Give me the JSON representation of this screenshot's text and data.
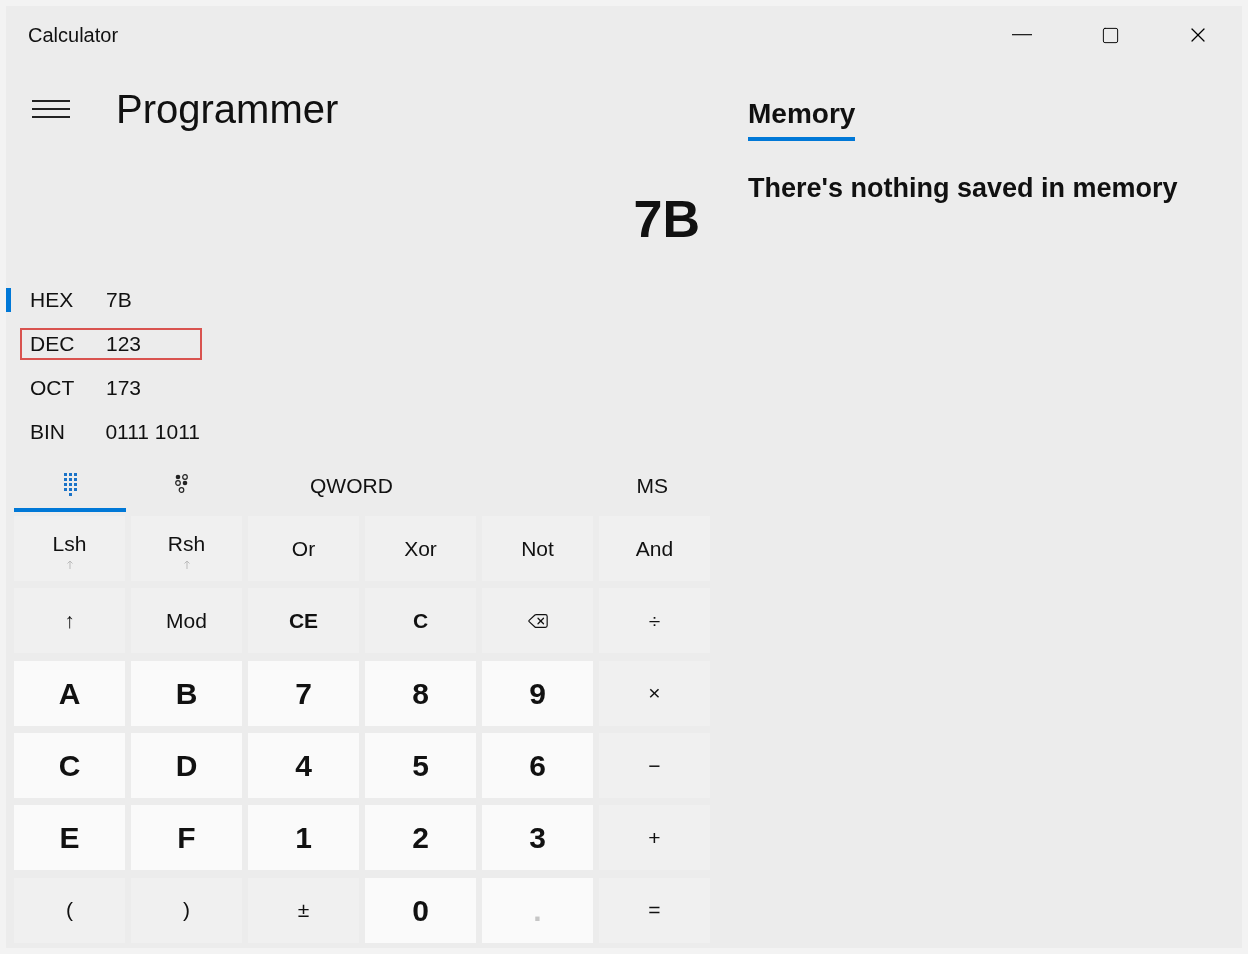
{
  "window": {
    "title": "Calculator"
  },
  "header": {
    "mode": "Programmer"
  },
  "display": {
    "value": "7B"
  },
  "radix": [
    {
      "label": "HEX",
      "value": "7B",
      "selected": true,
      "outlined": false
    },
    {
      "label": "DEC",
      "value": "123",
      "selected": false,
      "outlined": true
    },
    {
      "label": "OCT",
      "value": "173",
      "selected": false,
      "outlined": false
    },
    {
      "label": "BIN",
      "value": "0111 1011",
      "selected": false,
      "outlined": false
    }
  ],
  "keypad_tabs": [
    {
      "kind": "keypad",
      "selected": true
    },
    {
      "kind": "bits",
      "selected": false
    }
  ],
  "word_size": "QWORD",
  "memory_store": "MS",
  "keys": [
    {
      "kind": "op",
      "label": "Lsh",
      "sub_arrow": true,
      "disabled": false
    },
    {
      "kind": "op",
      "label": "Rsh",
      "sub_arrow": true,
      "disabled": false
    },
    {
      "kind": "op",
      "label": "Or",
      "disabled": false
    },
    {
      "kind": "op",
      "label": "Xor",
      "disabled": false
    },
    {
      "kind": "op",
      "label": "Not",
      "disabled": false
    },
    {
      "kind": "op",
      "label": "And",
      "disabled": false
    },
    {
      "kind": "op",
      "label": "↑",
      "disabled": false
    },
    {
      "kind": "op",
      "label": "Mod",
      "disabled": false
    },
    {
      "kind": "op",
      "label": "CE",
      "bold": true,
      "disabled": false
    },
    {
      "kind": "op",
      "label": "C",
      "bold": true,
      "disabled": false
    },
    {
      "kind": "backspace",
      "disabled": false
    },
    {
      "kind": "op",
      "label": "÷",
      "disabled": false
    },
    {
      "kind": "digit",
      "label": "A",
      "disabled": false
    },
    {
      "kind": "digit",
      "label": "B",
      "disabled": false
    },
    {
      "kind": "digit",
      "label": "7",
      "disabled": false
    },
    {
      "kind": "digit",
      "label": "8",
      "disabled": false
    },
    {
      "kind": "digit",
      "label": "9",
      "disabled": false
    },
    {
      "kind": "op",
      "label": "×",
      "disabled": false
    },
    {
      "kind": "digit",
      "label": "C",
      "disabled": false
    },
    {
      "kind": "digit",
      "label": "D",
      "disabled": false
    },
    {
      "kind": "digit",
      "label": "4",
      "disabled": false
    },
    {
      "kind": "digit",
      "label": "5",
      "disabled": false
    },
    {
      "kind": "digit",
      "label": "6",
      "disabled": false
    },
    {
      "kind": "op",
      "label": "−",
      "disabled": false
    },
    {
      "kind": "digit",
      "label": "E",
      "disabled": false
    },
    {
      "kind": "digit",
      "label": "F",
      "disabled": false
    },
    {
      "kind": "digit",
      "label": "1",
      "disabled": false
    },
    {
      "kind": "digit",
      "label": "2",
      "disabled": false
    },
    {
      "kind": "digit",
      "label": "3",
      "disabled": false
    },
    {
      "kind": "op",
      "label": "+",
      "disabled": false
    },
    {
      "kind": "op",
      "label": "(",
      "disabled": false
    },
    {
      "kind": "op",
      "label": ")",
      "disabled": false
    },
    {
      "kind": "op",
      "label": "±",
      "disabled": false
    },
    {
      "kind": "digit",
      "label": "0",
      "disabled": false
    },
    {
      "kind": "digit",
      "label": ".",
      "disabled": true
    },
    {
      "kind": "op",
      "label": "=",
      "disabled": false
    }
  ],
  "memory": {
    "tab": "Memory",
    "selected": true,
    "empty_text": "There's nothing saved in memory"
  }
}
